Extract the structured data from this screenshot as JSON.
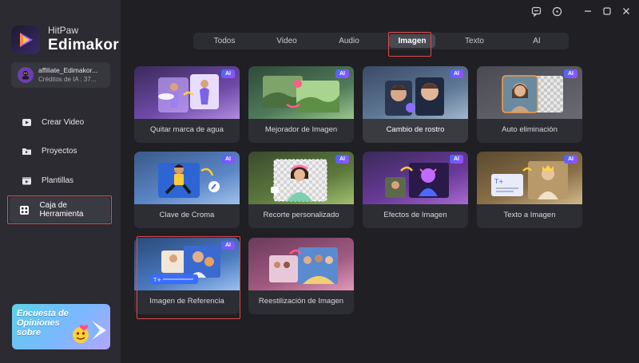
{
  "app": {
    "brand_top": "HitPaw",
    "brand_main": "Edimakor"
  },
  "user": {
    "name": "affiliate_Edimakor...",
    "credits": "Créditos de IA : 37..."
  },
  "sidebar": {
    "items": [
      {
        "label": "Crear Video",
        "icon": "video-icon"
      },
      {
        "label": "Proyectos",
        "icon": "folder-icon"
      },
      {
        "label": "Plantillas",
        "icon": "template-icon"
      },
      {
        "label": "Caja de Herramienta",
        "icon": "toolbox-icon"
      }
    ],
    "active_index": 3
  },
  "promo": {
    "text": "Encuesta de Opiniones sobre"
  },
  "tabs": [
    {
      "label": "Todos"
    },
    {
      "label": "Video"
    },
    {
      "label": "Audio"
    },
    {
      "label": "Imagen"
    },
    {
      "label": "Texto"
    },
    {
      "label": "AI"
    }
  ],
  "active_tab": 3,
  "badge_label": "AI",
  "cards": [
    {
      "label": "Quitar marca de agua",
      "ai": true
    },
    {
      "label": "Mejorador de Imagen",
      "ai": true
    },
    {
      "label": "Cambio de rostro",
      "ai": true
    },
    {
      "label": "Auto eliminación",
      "ai": true
    },
    {
      "label": "Clave de Croma",
      "ai": true
    },
    {
      "label": "Recorte personalizado",
      "ai": true
    },
    {
      "label": "Efectos de Imagen",
      "ai": true
    },
    {
      "label": "Texto a Imagen",
      "ai": true
    },
    {
      "label": "Imagen de Referencia",
      "ai": true
    },
    {
      "label": "Reestilización de Imagen",
      "ai": true
    }
  ],
  "colors": {
    "background": "#1f1f24",
    "sidebar": "#2b2b31",
    "card": "#2d2d34",
    "highlight": "#e04a4a",
    "ai_badge_start": "#3b6cff",
    "ai_badge_end": "#a34dff"
  }
}
